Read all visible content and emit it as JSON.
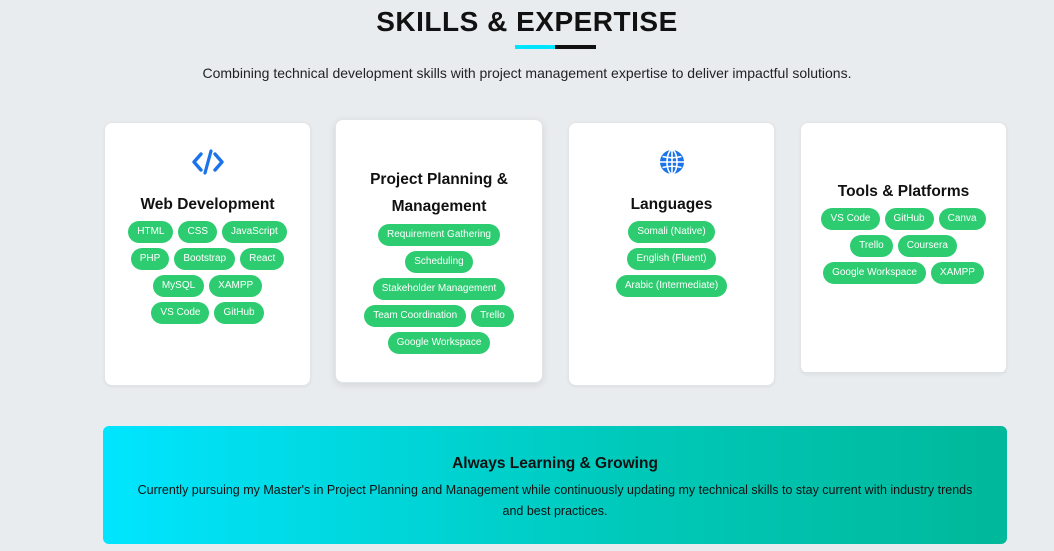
{
  "section": {
    "title": "SKILLS & EXPERTISE",
    "subtitle": "Combining technical development skills with project management expertise to deliver impactful solutions.",
    "accent_color": "#00e5ff",
    "dark_color": "#111111"
  },
  "cards": [
    {
      "icon": "code-icon",
      "title": "Web Development",
      "tags": [
        "HTML",
        "CSS",
        "JavaScript",
        "PHP",
        "Bootstrap",
        "React",
        "MySQL",
        "XAMPP",
        "VS Code",
        "GitHub"
      ]
    },
    {
      "icon": "",
      "title": "Project Planning & Management",
      "tags": [
        "Requirement Gathering",
        "Scheduling",
        "Stakeholder Management",
        "Team Coordination",
        "Trello",
        "Google Workspace"
      ]
    },
    {
      "icon": "globe-icon",
      "title": "Languages",
      "tags": [
        "Somali (Native)",
        "English (Fluent)",
        "Arabic (Intermediate)"
      ]
    },
    {
      "icon": "",
      "title": "Tools & Platforms",
      "tags": [
        "VS Code",
        "GitHub",
        "Canva",
        "Trello",
        "Coursera",
        "Google Workspace",
        "XAMPP"
      ]
    }
  ],
  "banner": {
    "title": "Always Learning & Growing",
    "text": "Currently pursuing my Master's in Project Planning and Management while continuously updating my technical skills to stay current with industry trends and best practices."
  },
  "colors": {
    "tag_green": "#2ecc71",
    "icon_blue": "#1a73e8",
    "banner_start": "#00e5ff",
    "banner_end": "#00b89a"
  }
}
